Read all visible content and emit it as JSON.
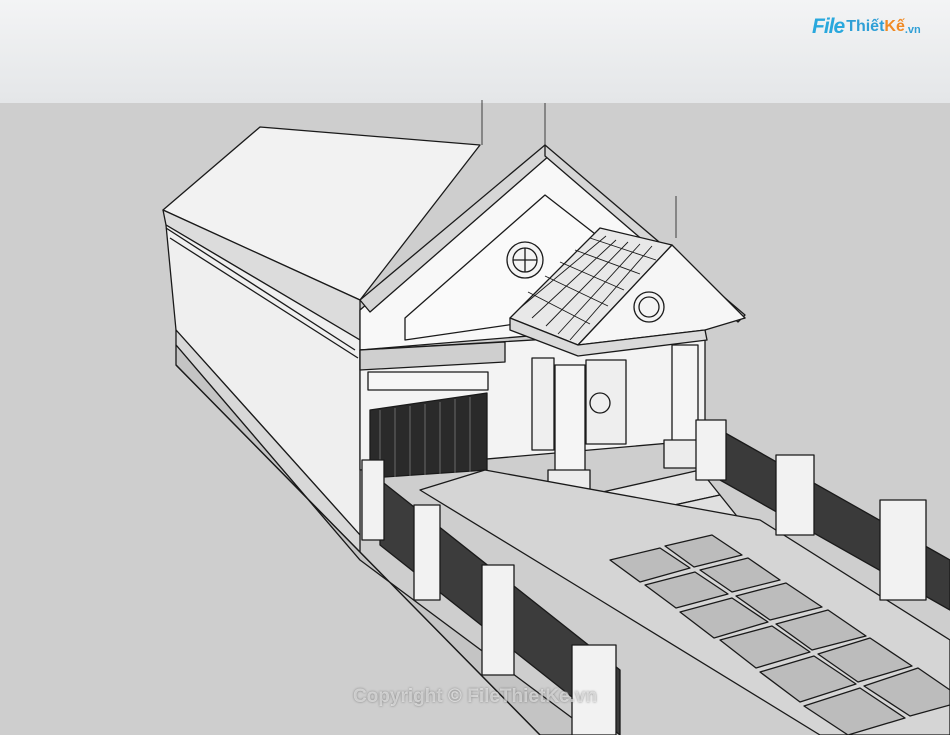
{
  "watermark": {
    "logo_file": "File",
    "logo_thiet": "Thiết",
    "logo_ke": "Kế",
    "logo_vn": ".vn",
    "copyright": "Copyright © FileThietKe.vn"
  },
  "scene": {
    "subject": "house-3d-model",
    "colors": {
      "sky": "#eeeff1",
      "ground": "#cecece",
      "wall": "#f7f7f7",
      "line": "#1a1a1a",
      "shade": "#bdbdbd"
    }
  }
}
